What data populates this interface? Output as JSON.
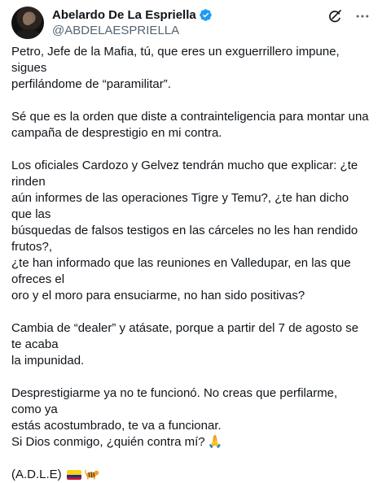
{
  "author": {
    "display_name": "Abelardo De La Espriella",
    "handle": "@ABDELAESPRIELLA",
    "verified": true
  },
  "header_icons": {
    "grok": "grok-icon",
    "more": "more-icon"
  },
  "tweet": {
    "paragraphs": [
      {
        "lines": [
          "Petro, Jefe de la Mafia, tú, que eres un exguerrillero impune, sigues",
          "perfilándome de “paramilitar”."
        ]
      },
      {
        "lines": [
          "Sé que es la orden que diste a contrainteligencia para montar una",
          "campaña de desprestigio en mi contra."
        ]
      },
      {
        "lines": [
          "Los oficiales Cardozo y Gelvez tendrán mucho que explicar: ¿te rinden",
          "aún informes de las operaciones Tigre y Temu?, ¿te han dicho que las",
          "búsquedas de falsos testigos en las cárceles no les han rendido frutos?,",
          "¿te han informado que las reuniones en Valledupar, en las que ofreces el",
          "oro y el moro para ensuciarme, no han sido positivas?"
        ]
      },
      {
        "lines": [
          "Cambia de “dealer” y atásate, porque a partir del 7 de agosto se te acaba",
          "la impunidad."
        ]
      },
      {
        "lines": [
          "Desprestigiarme ya no te funcionó. No creas que perfilarme, como ya",
          "estás acostumbrado, te va a funcionar."
        ],
        "last_line": "Si Dios conmigo, ¿quién contra mí?",
        "last_line_emoji": "🙏"
      }
    ],
    "signature": "(A.D.L.E)",
    "signature_emojis": [
      "colombia-flag-icon",
      "tiger-icon"
    ]
  },
  "colors": {
    "text": "#0f1419",
    "secondary": "#536471",
    "verified": "#1d9bf0"
  }
}
